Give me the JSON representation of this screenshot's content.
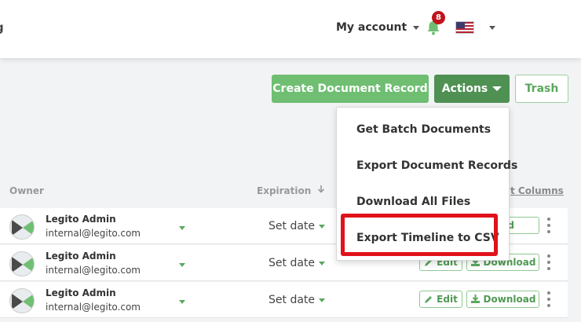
{
  "header": {
    "brand_fragment": "g",
    "account_label": "My account",
    "notification_count": "8",
    "language_flag": "us-flag-icon"
  },
  "toolbar": {
    "create_label": "Create Document Record",
    "actions_label": "Actions",
    "trash_label": "Trash"
  },
  "actions_menu": {
    "items": [
      "Get Batch Documents",
      "Export Document Records",
      "Download All Files",
      "Export Timeline to CSV"
    ],
    "highlighted_index": 3
  },
  "table": {
    "columns": {
      "owner": "Owner",
      "expiration": "Expiration",
      "columns_link": "t Columns"
    },
    "rows": [
      {
        "name": "Legito Admin",
        "email": "internal@legito.com",
        "expiration": "Set date",
        "edit": "",
        "download": "load"
      },
      {
        "name": "Legito Admin",
        "email": "internal@legito.com",
        "expiration": "Set date",
        "edit": "Edit",
        "download": "Download"
      },
      {
        "name": "Legito Admin",
        "email": "internal@legito.com",
        "expiration": "Set date",
        "edit": "Edit",
        "download": "Download"
      }
    ]
  },
  "colors": {
    "primary_green": "#6fbe72",
    "dark_green": "#4f9153",
    "highlight_red": "#e0121b",
    "badge_red": "#c0131b"
  }
}
